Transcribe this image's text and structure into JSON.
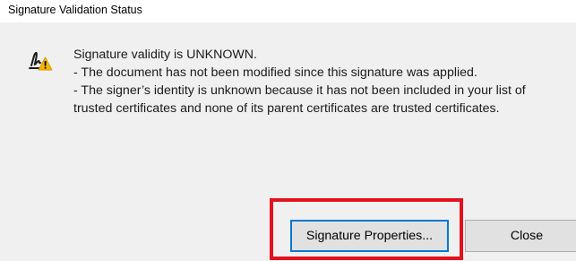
{
  "window": {
    "title": "Signature Validation Status"
  },
  "message": {
    "icon": "signature-warning-icon",
    "lines": [
      "Signature validity is UNKNOWN.",
      "- The document has not been modified since this signature was applied.",
      "- The signer’s identity is unknown because it has not been included in your list of",
      "trusted certificates and none of its parent certificates are trusted certificates."
    ]
  },
  "buttons": {
    "properties_label": "Signature Properties...",
    "close_label": "Close"
  },
  "colors": {
    "highlight": "#e3121d",
    "focus_border": "#0078d7",
    "warning": "#f5b800",
    "background": "#f0f0f0"
  }
}
